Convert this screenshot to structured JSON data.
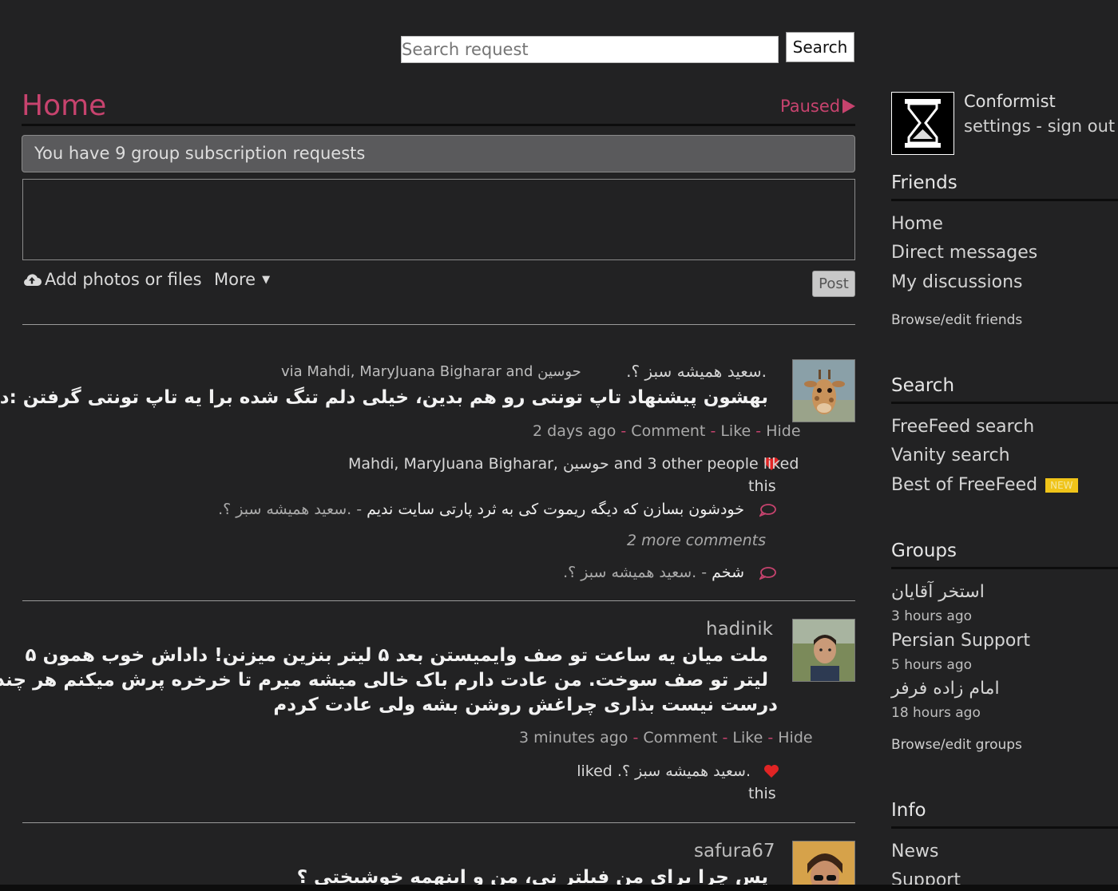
{
  "search": {
    "placeholder": "Search request",
    "button_label": "Search"
  },
  "home": {
    "title": "Home",
    "paused_label": "Paused",
    "subscription_requests": "You have 9 group subscription requests",
    "add_photos_label": "Add photos or files",
    "more_label": "More",
    "post_button": "Post"
  },
  "posts": [
    {
      "author_line": ".سعید همیشه سبز ؟.",
      "via_line": "via Mahdi, MaryJuana Bigharar and حوسین",
      "body": "بهشون پیشنهاد تاپ تونتی رو هم بدین، خیلی دلم تنگ شده برا یه تاپ تونتی گرفتن :دی",
      "meta": {
        "time": "2 days ago",
        "comment": "Comment",
        "like": "Like",
        "hide": "Hide"
      },
      "likes_line1": "Mahdi, MaryJuana Bigharar, حوسین and 3 other people liked",
      "likes_line2": "this",
      "comments": [
        {
          "text": "خودشون بسازن که دیگه ریموت کی به ثرد پارتی سایت ندیم",
          "author": "- .سعید همیشه سبز ؟."
        },
        {
          "text": "شخم",
          "author": "- .سعید همیشه سبز ؟."
        }
      ],
      "more_comments": "2 more comments"
    },
    {
      "author_line": "hadinik",
      "body_lines": [
        "ملت میان یه ساعت تو صف وایمیستن بعد ۵ لیتر بنزین میزنن! داداش خوب همون ۵",
        "لیتر تو صف سوخت. من عادت دارم باک خالی میشه میرم تا خرخره پرش میکنم هر چند",
        "درست نیست بذاری چراغش روشن بشه ولی عادت کردم"
      ],
      "meta": {
        "time": "3 minutes ago",
        "comment": "Comment",
        "like": "Like",
        "hide": "Hide"
      },
      "likes_line1": ".سعید همیشه سبز ؟. liked",
      "likes_line2": "this"
    },
    {
      "author_line": "safura67",
      "body": "پس چرا برای من فیلتر نی، من و اینهمه خوشبختی ؟"
    }
  ],
  "sidebar": {
    "username": "Conformist",
    "settings_label": "settings",
    "signout_label": "sign out",
    "user_sep": " - ",
    "friends": {
      "title": "Friends",
      "items": [
        "Home",
        "Direct messages",
        "My discussions"
      ],
      "browse": "Browse/edit friends"
    },
    "search": {
      "title": "Search",
      "items": [
        "FreeFeed search",
        "Vanity search",
        "Best of FreeFeed"
      ],
      "badge": "NEW"
    },
    "groups": {
      "title": "Groups",
      "items": [
        {
          "name": "استخر آقایان",
          "time": "3 hours ago"
        },
        {
          "name": "Persian Support",
          "time": "5 hours ago"
        },
        {
          "name": "امام زاده فرفر",
          "time": "18 hours ago"
        }
      ],
      "browse": "Browse/edit groups"
    },
    "info": {
      "title": "Info",
      "items": [
        "News",
        "Support"
      ]
    }
  },
  "colors": {
    "accent": "#c7436e",
    "heart": "#e02424",
    "badge": "#f0c419",
    "background": "#222223"
  }
}
